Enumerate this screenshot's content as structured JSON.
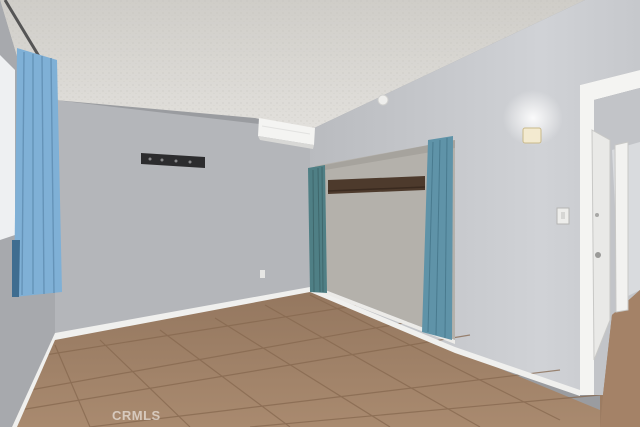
{
  "watermark": {
    "text": "CRMLS"
  },
  "colors": {
    "ceiling": "#d8d6d2",
    "wall_back": "#b7b9bd",
    "wall_right": "#c4c6ca",
    "wall_left": "#a9abaf",
    "floor_tile": "#a07f64",
    "grout": "#8a6c55",
    "curtain": "#5f8fae",
    "closet_interior": "#b6b3ad",
    "trim": "#f2f2f0"
  },
  "icons": [
    "window-curtain",
    "wall-mounted-ac-unit",
    "wall-sconce-light",
    "light-switch",
    "wall-mount-bracket"
  ]
}
